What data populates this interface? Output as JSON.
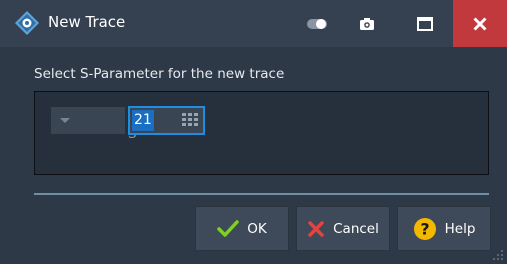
{
  "window": {
    "title": "New Trace",
    "icons": [
      "app-logo-icon",
      "toggle-icon",
      "camera-icon",
      "maximize-icon",
      "close-icon"
    ],
    "colors": {
      "titlebar": "#354150",
      "close": "#c1383d",
      "accent": "#1e8fe0"
    }
  },
  "body": {
    "prompt": "Select S-Parameter for the new trace",
    "s_prefix": "S",
    "s_value": "21"
  },
  "buttons": {
    "ok": "OK",
    "cancel": "Cancel",
    "help": "Help"
  }
}
